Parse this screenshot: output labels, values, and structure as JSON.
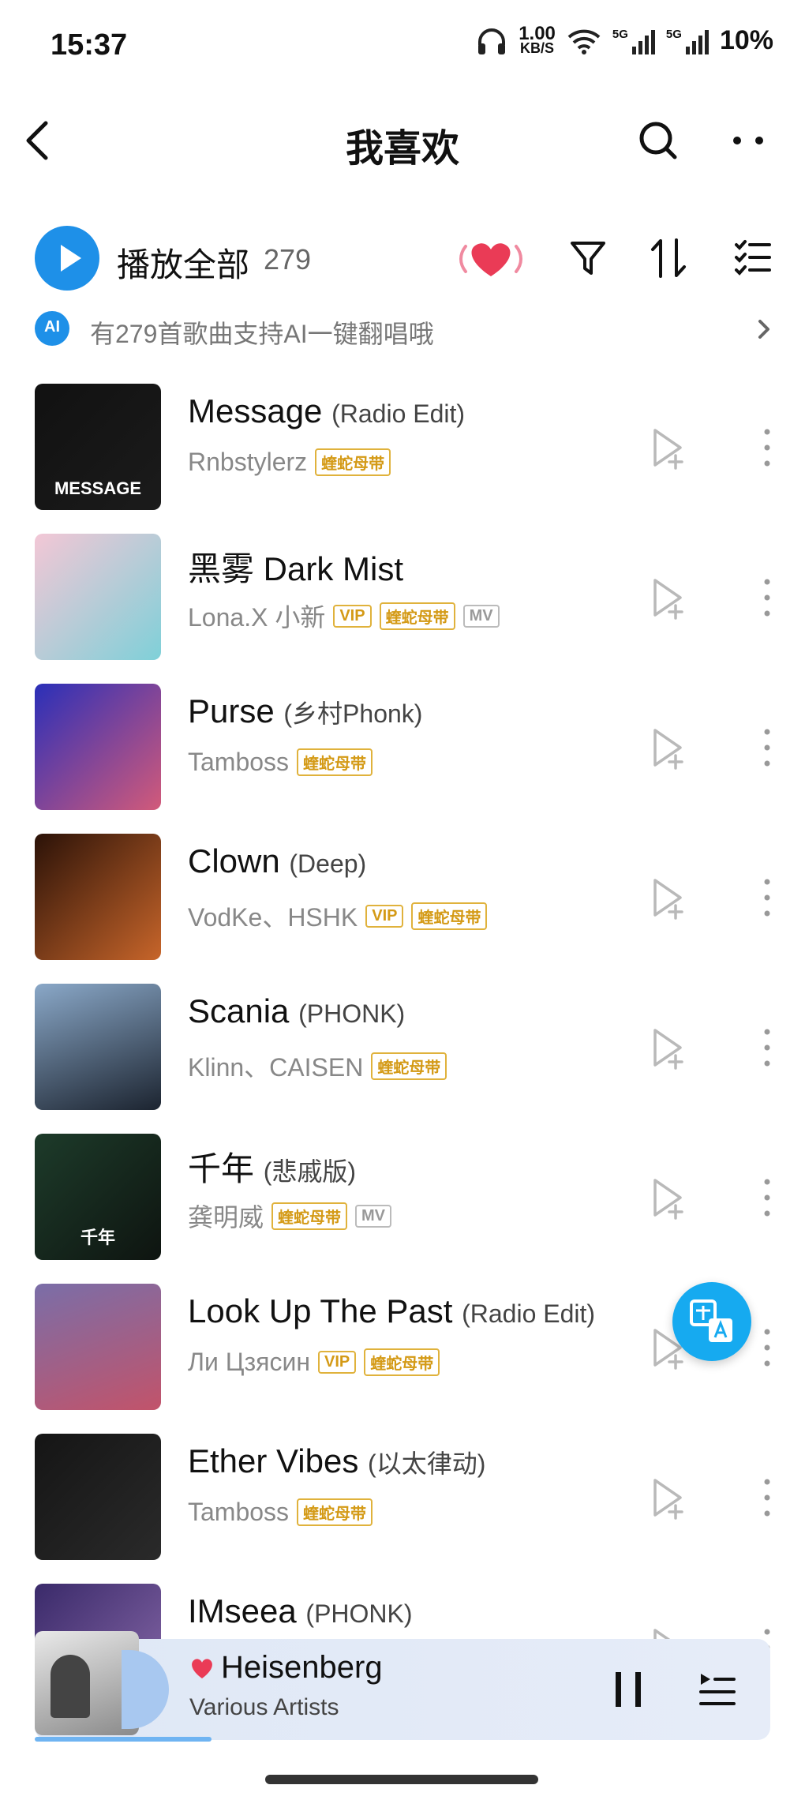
{
  "status_bar": {
    "time": "15:37",
    "speed_value": "1.00",
    "speed_unit": "KB/S",
    "signal1_label": "5G",
    "signal2_label": "5G",
    "battery": "10%"
  },
  "header": {
    "title": "我喜欢",
    "back_icon": "chevron-left-icon",
    "search_icon": "search-icon",
    "more_icon": "more-dots-icon"
  },
  "play_all": {
    "label": "播放全部",
    "count": "279"
  },
  "ai_banner": {
    "badge": "AI",
    "text": "有279首歌曲支持AI一键翻唱哦"
  },
  "songs": [
    {
      "title": "Message",
      "subtitle": "(Radio Edit)",
      "artist": "Rnbstylerz",
      "tags": [
        "蝰蛇母带"
      ],
      "cover_text": "MESSAGE"
    },
    {
      "title": "黑雾 Dark Mist",
      "subtitle": "",
      "artist": "Lona.X 小新",
      "tags": [
        "VIP",
        "蝰蛇母带",
        "MV"
      ],
      "cover_text": ""
    },
    {
      "title": "Purse",
      "subtitle": "(乡村Phonk)",
      "artist": "Tamboss",
      "tags": [
        "蝰蛇母带"
      ],
      "cover_text": ""
    },
    {
      "title": "Clown",
      "subtitle": "(Deep)",
      "artist": "VodKe、HSHK",
      "tags": [
        "VIP",
        "蝰蛇母带"
      ],
      "cover_text": ""
    },
    {
      "title": "Scania",
      "subtitle": "(PHONK)",
      "artist": "Klinn、CAISEN",
      "tags": [
        "蝰蛇母带"
      ],
      "cover_text": ""
    },
    {
      "title": "千年",
      "subtitle": "(悲戚版)",
      "artist": "龚明威",
      "tags": [
        "蝰蛇母带",
        "MV"
      ],
      "cover_text": "千年"
    },
    {
      "title": "Look Up The Past",
      "subtitle": "(Radio Edit)",
      "artist": "Ли Цзясин",
      "tags": [
        "VIP",
        "蝰蛇母带"
      ],
      "cover_text": ""
    },
    {
      "title": "Ether Vibes",
      "subtitle": "(以太律动)",
      "artist": "Tamboss",
      "tags": [
        "蝰蛇母带"
      ],
      "cover_text": ""
    },
    {
      "title": "IMseea",
      "subtitle": "(PHONK)",
      "artist": "",
      "tags": [],
      "cover_text": ""
    }
  ],
  "now_playing": {
    "title": "Heisenberg",
    "artist": "Various Artists",
    "progress": 0.24
  },
  "colors": {
    "accent": "#1e90e8",
    "tag_gold": "#d49a16",
    "heart": "#ea3b56"
  }
}
